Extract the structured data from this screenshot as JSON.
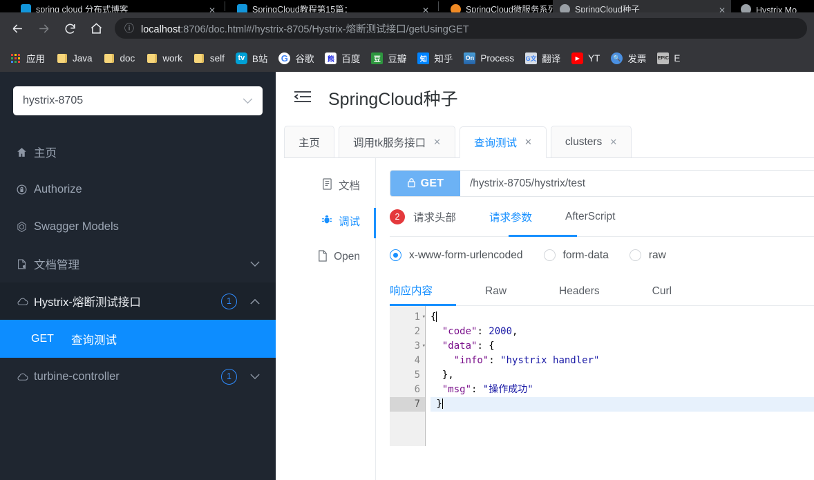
{
  "browser": {
    "tabs": [
      {
        "title": "spring cloud  分布式博客",
        "favicon": "bilibili-icon",
        "active": false
      },
      {
        "title": "SpringCloud教程第15篇：",
        "favicon": "bilibili-icon",
        "active": false
      },
      {
        "title": "SpringCloud微服务系列",
        "favicon": "flame-icon",
        "active": false
      },
      {
        "title": "SpringCloud种子",
        "favicon": "chrome-icon",
        "active": true
      },
      {
        "title": "Hystrix Mo",
        "favicon": "chrome-icon",
        "active": false
      }
    ],
    "toolbar": {
      "back": "←",
      "forward": "→",
      "reload": "⟳",
      "home": "⌂"
    },
    "omnibox": {
      "info_icon": "ⓘ",
      "host": "localhost",
      "rest": ":8706/doc.html#/hystrix-8705/Hystrix-熔断测试接口/getUsingGET"
    },
    "bookmarks": [
      {
        "label": "应用",
        "icon": "apps-grid-icon"
      },
      {
        "label": "Java",
        "icon": "folder-icon"
      },
      {
        "label": "doc",
        "icon": "folder-icon"
      },
      {
        "label": "work",
        "icon": "folder-icon"
      },
      {
        "label": "self",
        "icon": "folder-icon"
      },
      {
        "label": "B站",
        "icon": "bilibili-icon"
      },
      {
        "label": "谷歌",
        "icon": "google-icon"
      },
      {
        "label": "百度",
        "icon": "baidu-icon"
      },
      {
        "label": "豆瓣",
        "icon": "douban-icon"
      },
      {
        "label": "知乎",
        "icon": "zhihu-icon"
      },
      {
        "label": "Process",
        "icon": "on-icon"
      },
      {
        "label": "翻译",
        "icon": "google-translate-icon"
      },
      {
        "label": "YT",
        "icon": "youtube-icon"
      },
      {
        "label": "发票",
        "icon": "magnifier-icon"
      },
      {
        "label": "E",
        "icon": "epic-icon"
      }
    ]
  },
  "sidebar": {
    "service_select": {
      "value": "hystrix-8705",
      "caret": "⌄"
    },
    "nav": [
      {
        "label": "主页",
        "icon": "home-icon",
        "badge": null,
        "chevron": null
      },
      {
        "label": "Authorize",
        "icon": "lock-icon",
        "badge": null,
        "chevron": null
      },
      {
        "label": "Swagger Models",
        "icon": "cube-icon",
        "badge": null,
        "chevron": null
      },
      {
        "label": "文档管理",
        "icon": "doc-settings-icon",
        "badge": null,
        "chevron": "⌄"
      },
      {
        "label": "Hystrix-熔断测试接口",
        "icon": "cloud-icon",
        "badge": "1",
        "chevron": "⌃"
      }
    ],
    "api_item": {
      "method": "GET",
      "name": "查询测试"
    },
    "nav_after": [
      {
        "label": "turbine-controller",
        "icon": "cloud-icon",
        "badge": "1",
        "chevron": "⌄"
      }
    ]
  },
  "main": {
    "collapse_icon": "collapse-menu-icon",
    "title": "SpringCloud种子",
    "doc_tabs": [
      {
        "label": "主页",
        "closable": false,
        "active": false
      },
      {
        "label": "调用tk服务接口",
        "closable": true,
        "active": false
      },
      {
        "label": "查询测试",
        "closable": true,
        "active": true
      },
      {
        "label": "clusters",
        "closable": true,
        "active": false
      }
    ],
    "inner_nav": [
      {
        "label": "文档",
        "icon": "document-icon",
        "active": false
      },
      {
        "label": "调试",
        "icon": "bug-icon",
        "active": true
      },
      {
        "label": "Open",
        "icon": "file-icon",
        "active": false
      }
    ],
    "request": {
      "method": "GET",
      "lock_icon": "lock-icon",
      "url": "/hystrix-8705/hystrix/test",
      "tabs": [
        {
          "label": "请求头部",
          "badge": "2",
          "active": false
        },
        {
          "label": "请求参数",
          "badge": null,
          "active": true
        },
        {
          "label": "AfterScript",
          "badge": null,
          "active": false
        }
      ],
      "body_types": [
        {
          "label": "x-www-form-urlencoded",
          "checked": true
        },
        {
          "label": "form-data",
          "checked": false
        },
        {
          "label": "raw",
          "checked": false
        }
      ]
    },
    "response": {
      "tabs": [
        {
          "label": "响应内容",
          "active": true
        },
        {
          "label": "Raw",
          "active": false
        },
        {
          "label": "Headers",
          "active": false
        },
        {
          "label": "Curl",
          "active": false
        }
      ],
      "code_lines": [
        {
          "no": "1",
          "fold": "▾",
          "current": false,
          "tokens": [
            {
              "t": "{",
              "c": "punct"
            }
          ]
        },
        {
          "no": "2",
          "fold": "",
          "current": false,
          "tokens": [
            {
              "t": "  ",
              "c": "punct"
            },
            {
              "t": "\"code\"",
              "c": "key"
            },
            {
              "t": ": ",
              "c": "punct"
            },
            {
              "t": "2000",
              "c": "num"
            },
            {
              "t": ",",
              "c": "punct"
            }
          ]
        },
        {
          "no": "3",
          "fold": "▾",
          "current": false,
          "tokens": [
            {
              "t": "  ",
              "c": "punct"
            },
            {
              "t": "\"data\"",
              "c": "key"
            },
            {
              "t": ": {",
              "c": "punct"
            }
          ]
        },
        {
          "no": "4",
          "fold": "",
          "current": false,
          "tokens": [
            {
              "t": "    ",
              "c": "punct"
            },
            {
              "t": "\"info\"",
              "c": "key"
            },
            {
              "t": ": ",
              "c": "punct"
            },
            {
              "t": "\"hystrix handler\"",
              "c": "str"
            }
          ]
        },
        {
          "no": "5",
          "fold": "",
          "current": false,
          "tokens": [
            {
              "t": "  },",
              "c": "punct"
            }
          ]
        },
        {
          "no": "6",
          "fold": "",
          "current": false,
          "tokens": [
            {
              "t": "  ",
              "c": "punct"
            },
            {
              "t": "\"msg\"",
              "c": "key"
            },
            {
              "t": ": ",
              "c": "punct"
            },
            {
              "t": "\"操作成功\"",
              "c": "str"
            }
          ]
        },
        {
          "no": "7",
          "fold": "",
          "current": true,
          "tokens": [
            {
              "t": " }",
              "c": "punct"
            }
          ]
        }
      ]
    }
  },
  "colors": {
    "accent_blue": "#1890ff",
    "sidebar_bg": "#1f2630",
    "selected_api": "#0d8dff",
    "badge_red": "#e4393c",
    "method_get": "#6cb2f5",
    "browser_chrome": "#35363a"
  }
}
